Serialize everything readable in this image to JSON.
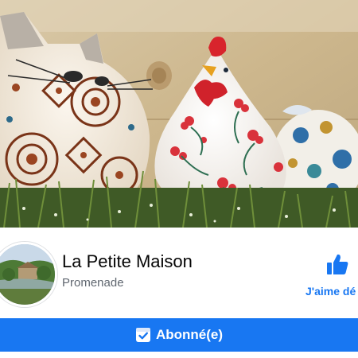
{
  "page": {
    "name": "La Petite Maison",
    "category": "Promenade"
  },
  "actions": {
    "like_label": "J'aime dé",
    "subscribe_label": "Abonné(e)"
  },
  "icons": {
    "like": "thumbs-up-icon",
    "subscribed": "check-box-icon"
  },
  "colors": {
    "brand_blue": "#1877f2",
    "text_primary": "#050505",
    "text_secondary": "#606770"
  }
}
